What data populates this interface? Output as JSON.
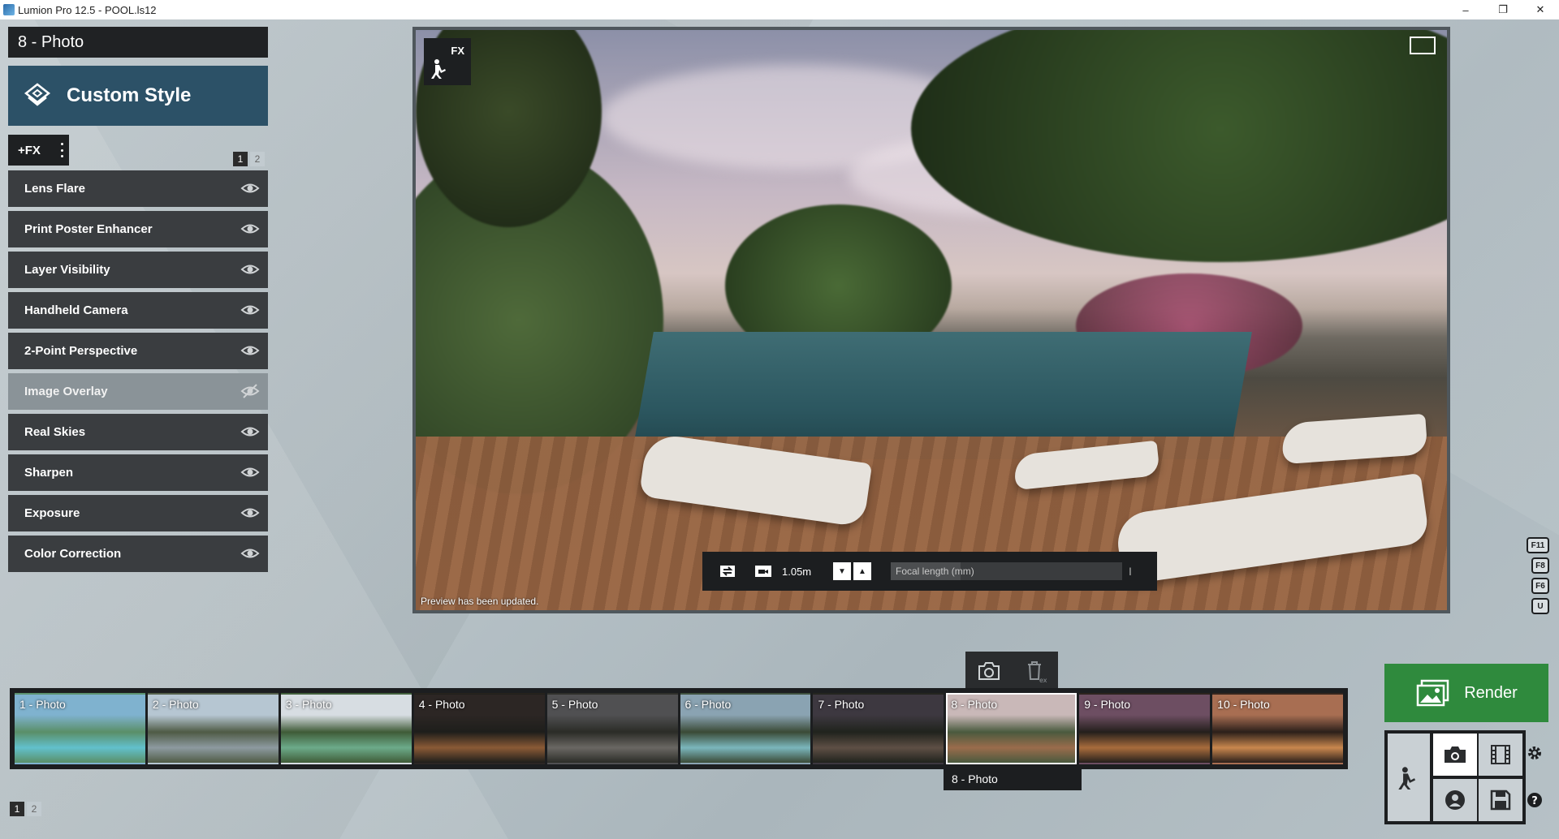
{
  "window": {
    "title": "Lumion Pro 12.5 - POOL.ls12",
    "minimize": "–",
    "maximize": "❐",
    "close": "✕"
  },
  "left_panel": {
    "photo_name": "8 - Photo",
    "style_label": "Custom Style",
    "add_fx_label": "+FX",
    "pages": [
      "1",
      "2"
    ],
    "effects": [
      {
        "label": "Lens Flare",
        "visible": true
      },
      {
        "label": "Print Poster Enhancer",
        "visible": true
      },
      {
        "label": "Layer Visibility",
        "visible": true
      },
      {
        "label": "Handheld Camera",
        "visible": true
      },
      {
        "label": "2-Point Perspective",
        "visible": true
      },
      {
        "label": "Image Overlay",
        "visible": false
      },
      {
        "label": "Real Skies",
        "visible": true
      },
      {
        "label": "Sharpen",
        "visible": true
      },
      {
        "label": "Exposure",
        "visible": true
      },
      {
        "label": "Color Correction",
        "visible": true
      }
    ]
  },
  "preview": {
    "fx_badge": "FX",
    "status": "Preview has been updated.",
    "camera_height": "1.05m",
    "focal_label": "Focal length (mm)",
    "focal_fill": 0.3
  },
  "keys": [
    "F11",
    "F8",
    "F6",
    "U"
  ],
  "filmstrip": {
    "thumbs": [
      {
        "label": "1 - Photo",
        "colors": [
          "#7fb2cf",
          "#5a8f68",
          "#62c0cc"
        ]
      },
      {
        "label": "2 - Photo",
        "colors": [
          "#b6c6d2",
          "#4f5b45",
          "#8d9aa0"
        ]
      },
      {
        "label": "3 - Photo",
        "colors": [
          "#d7dde2",
          "#3f5b37",
          "#6cab8a"
        ]
      },
      {
        "label": "4 - Photo",
        "colors": [
          "#2c2624",
          "#1e1e1b",
          "#8a5a36"
        ]
      },
      {
        "label": "5 - Photo",
        "colors": [
          "#505052",
          "#2b2c27",
          "#6a6763"
        ]
      },
      {
        "label": "6 - Photo",
        "colors": [
          "#8aa3b2",
          "#3a4a36",
          "#7bb6bc"
        ]
      },
      {
        "label": "7 - Photo",
        "colors": [
          "#3d3840",
          "#20231d",
          "#5e4f45"
        ]
      },
      {
        "label": "8 - Photo",
        "colors": [
          "#c9b8b8",
          "#4a5a3e",
          "#9a6c4c"
        ],
        "selected": true
      },
      {
        "label": "9 - Photo",
        "colors": [
          "#6d4e62",
          "#241f1c",
          "#a86c3c"
        ]
      },
      {
        "label": "10 - Photo",
        "colors": [
          "#a86e52",
          "#2b1f1a",
          "#c9874e"
        ]
      }
    ],
    "tooltip": "8 - Photo",
    "pages": [
      "1",
      "2"
    ]
  },
  "render": {
    "label": "Render",
    "accent": "#2f8a3d"
  },
  "icons": {
    "camera": "camera-icon",
    "delete": "delete-icon",
    "settings": "gear-icon",
    "help": "help-icon"
  }
}
